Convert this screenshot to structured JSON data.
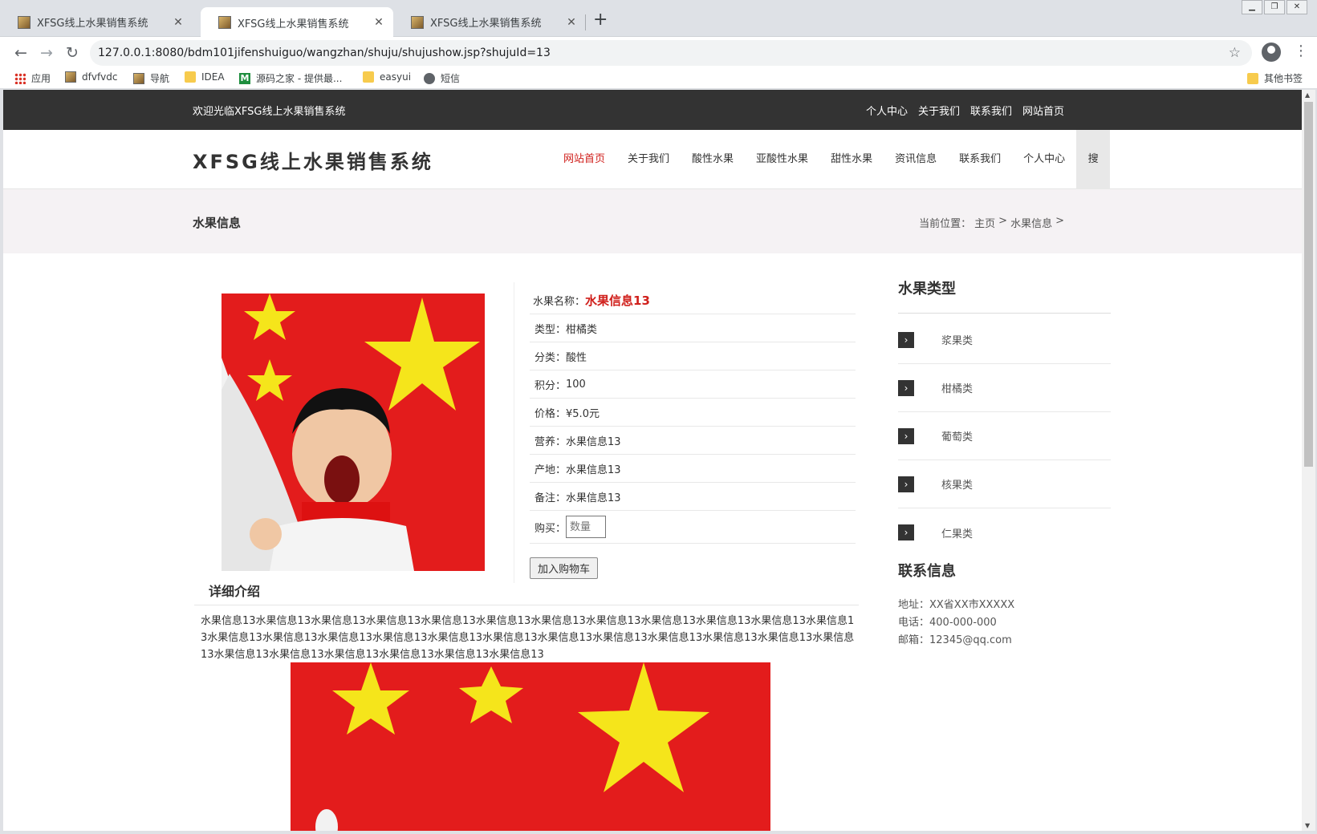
{
  "browser": {
    "tabs": [
      {
        "title": "XFSG线上水果销售系统",
        "active": false
      },
      {
        "title": "XFSG线上水果销售系统",
        "active": true
      },
      {
        "title": "XFSG线上水果销售系统",
        "active": false
      }
    ],
    "url": "127.0.0.1:8080/bdm101jifenshuiguo/wangzhan/shuju/shujushow.jsp?shujuId=13",
    "bookmarks": [
      {
        "label": "应用",
        "icon": "apps-grid-icon"
      },
      {
        "label": "dfvfvdc",
        "icon": "page-favicon-icon"
      },
      {
        "label": "导航",
        "icon": "page-favicon-icon"
      },
      {
        "label": "IDEA",
        "icon": "folder-icon"
      },
      {
        "label": "源码之家 - 提供最...",
        "icon": "m-logo-icon"
      },
      {
        "label": "easyui",
        "icon": "folder-icon"
      },
      {
        "label": "短信",
        "icon": "globe-icon"
      }
    ],
    "other_bookmarks": "其他书签"
  },
  "site": {
    "welcome": "欢迎光临XFSG线上水果销售系统",
    "top_links": [
      "个人中心",
      "关于我们",
      "联系我们",
      "网站首页"
    ],
    "logo": "XFSG线上水果销售系统",
    "nav": [
      "网站首页",
      "关于我们",
      "酸性水果",
      "亚酸性水果",
      "甜性水果",
      "资讯信息",
      "联系我们",
      "个人中心"
    ],
    "nav_active": "网站首页",
    "search_label": "搜",
    "banner_title": "水果信息",
    "breadcrumb": {
      "prefix": "当前位置：",
      "home": "主页",
      "sep": ">",
      "current": "水果信息",
      "tail": ">"
    }
  },
  "product": {
    "name_label": "水果名称：",
    "name": "水果信息13",
    "fields": [
      {
        "label": "类型：",
        "value": "柑橘类"
      },
      {
        "label": "分类：",
        "value": "酸性"
      },
      {
        "label": "积分：",
        "value": "100"
      },
      {
        "label": "价格：",
        "value": "¥5.0元"
      },
      {
        "label": "营养：",
        "value": "水果信息13"
      },
      {
        "label": "产地：",
        "value": "水果信息13"
      },
      {
        "label": "备注：",
        "value": "水果信息13"
      }
    ],
    "buy_label": "购买：",
    "qty_placeholder": "数量",
    "add_to_cart": "加入购物车",
    "detail_title": "详细介绍",
    "detail_text": "水果信息13水果信息13水果信息13水果信息13水果信息13水果信息13水果信息13水果信息13水果信息13水果信息13水果信息13水果信息13水果信息13水果信息13水果信息13水果信息13水果信息13水果信息13水果信息13水果信息13水果信息13水果信息13水果信息13水果信息13水果信息13水果信息13水果信息13水果信息13水果信息13水果信息13"
  },
  "sidebar": {
    "types_title": "水果类型",
    "types": [
      "浆果类",
      "柑橘类",
      "葡萄类",
      "核果类",
      "仁果类"
    ],
    "contact_title": "联系信息",
    "contact": {
      "address": "地址：XX省XX市XXXXX",
      "phone": "电话：400-000-000",
      "email": "邮箱：12345@qq.com"
    }
  },
  "colors": {
    "accent": "#d0201c",
    "topbar": "#333333",
    "banner_bg": "#f5f2f4"
  }
}
